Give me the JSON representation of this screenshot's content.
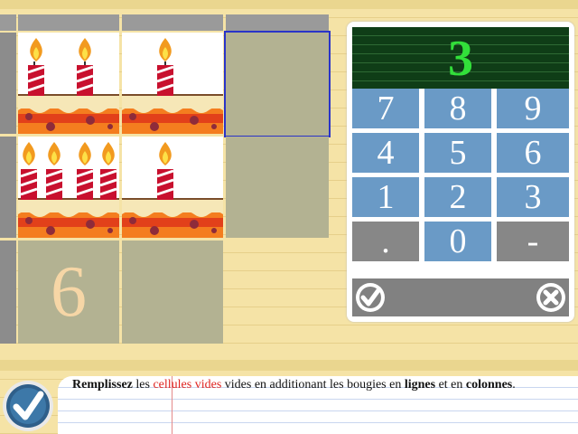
{
  "display": {
    "value": "3"
  },
  "keypad": {
    "rows": [
      [
        "7",
        "8",
        "9"
      ],
      [
        "4",
        "5",
        "6"
      ],
      [
        "1",
        "2",
        "3"
      ],
      [
        ".",
        "0",
        "-"
      ]
    ]
  },
  "grid": {
    "row1": {
      "candles_col1": 2,
      "candles_col2": 1
    },
    "row2": {
      "candles_col1": 4,
      "candles_col2": 1
    },
    "total_row_col1": "6"
  },
  "instruction": {
    "p1": "Remplissez",
    "p2": " les ",
    "p3": "cellules vides",
    "p4": " vides en additionant les bougies en ",
    "p5": "lignes",
    "p6": " et en ",
    "p7": "colonnes",
    "p8": "."
  },
  "colors": {
    "accent": "#2a34c8",
    "display_text": "#32e03a",
    "key": "#6a9ac6"
  }
}
